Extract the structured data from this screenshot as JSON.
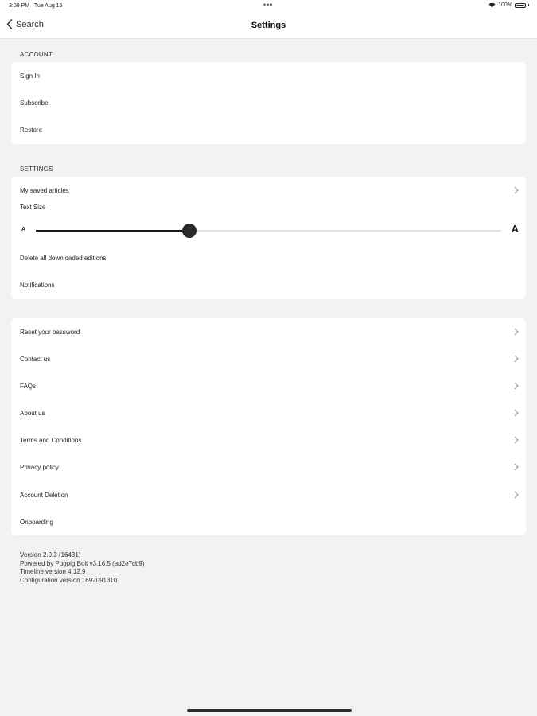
{
  "status": {
    "time": "3:09 PM",
    "date": "Tue Aug 15",
    "dots": "•••",
    "battery": "100%"
  },
  "nav": {
    "back_label": "Search",
    "title": "Settings"
  },
  "account": {
    "header": "ACCOUNT",
    "items": [
      "Sign In",
      "Subscribe",
      "Restore"
    ]
  },
  "settings": {
    "header": "SETTINGS",
    "saved_articles": "My saved articles",
    "text_size_label": "Text Size",
    "text_size_small": "A",
    "text_size_large": "A",
    "text_size_value": 0.33,
    "delete_downloads": "Delete all downloaded editions",
    "notifications": "Notifications"
  },
  "more": {
    "items": [
      "Reset your password",
      "Contact us",
      "FAQs",
      "About us",
      "Terms and Conditions",
      "Privacy policy",
      "Account Deletion",
      "Onboarding"
    ]
  },
  "version_info": {
    "version": "Version 2.9.3 (16431)",
    "powered_by": "Powered by Pugpig Bolt v3.16.5 (ad2e7cb9)",
    "timeline": "Timeline version 4.12.9",
    "configuration": "Configuration version 1692091310"
  },
  "colors": {
    "background": "#f2f2f2",
    "card": "#ffffff",
    "accent": "#1a1a1a"
  }
}
